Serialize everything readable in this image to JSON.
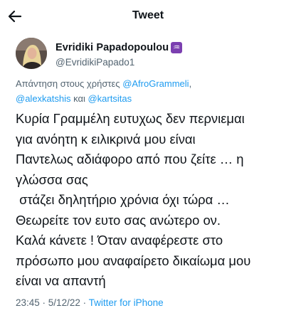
{
  "header": {
    "title": "Tweet",
    "back_icon": "arrow-left-icon"
  },
  "author": {
    "display_name": "Evridiki Papadopoulou",
    "badge": "♒",
    "badge_color": "#7b3fb0",
    "handle": "@EvridikiPapado1"
  },
  "reply": {
    "prefix": "Απάντηση στους χρήστες ",
    "mention1": "@AfroGrammeli",
    "comma": ",",
    "mention2": "@alexkatshis",
    "joiner": " και ",
    "mention3": "@kartsitas"
  },
  "tweet": {
    "lines": [
      "Κυρία Γραμμέλη ευτυχως δεν περνιεμαι",
      "για ανόητη κ ειλικρινά μου είναι",
      "Παντελως αδιάφορο από που ζείτε … η",
      "γλώσσα σας",
      " στάζει δηλητήριο χρόνια όχι τώρα …",
      "Θεωρείτε τον ευτο σας ανώτερο ον.",
      "Καλά κάνετε ! Όταν αναφέρεστε στο",
      "πρόσωπο μου αναφαίρετο δικαίωμα μου",
      "είναι να απαντή"
    ]
  },
  "meta": {
    "time": "23:45",
    "sep1": " · ",
    "date": "5/12/22",
    "sep2": " · ",
    "client": "Twitter for iPhone"
  },
  "colors": {
    "link": "#1d9bf0",
    "secondary": "#536471",
    "text": "#0f1419"
  }
}
